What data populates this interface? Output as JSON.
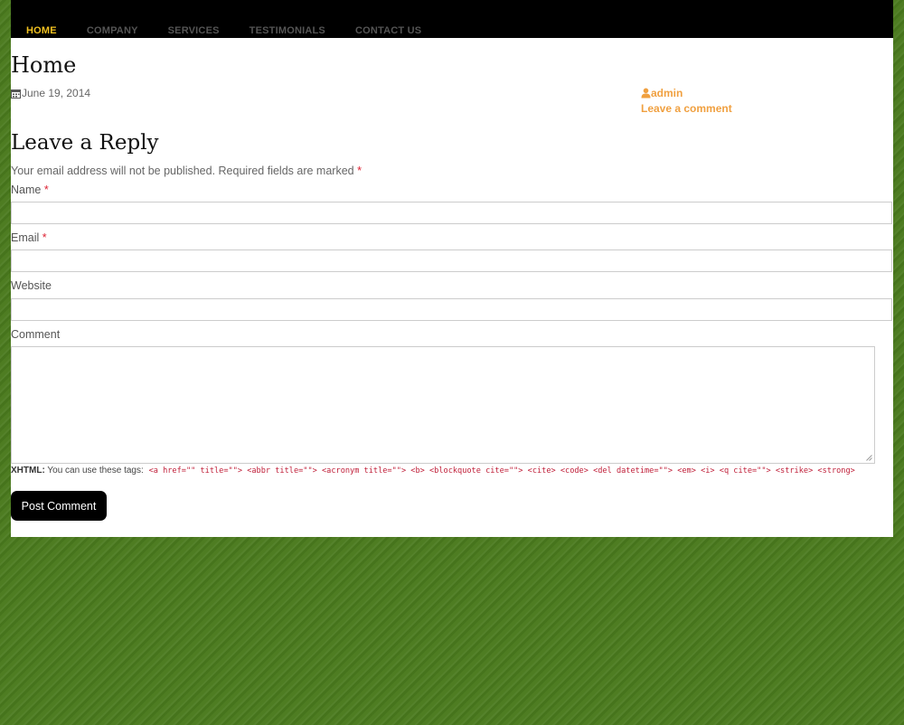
{
  "nav": {
    "items": [
      {
        "label": "HOME",
        "active": true
      },
      {
        "label": "COMPANY",
        "active": false
      },
      {
        "label": "SERVICES",
        "active": false
      },
      {
        "label": "TESTIMONIALS",
        "active": false
      },
      {
        "label": "CONTACT US",
        "active": false
      }
    ]
  },
  "post": {
    "title": "Home",
    "date": "June 19, 2014",
    "author": "admin",
    "comment_link": "Leave a comment"
  },
  "reply": {
    "title": "Leave a Reply",
    "notes": "Your email address will not be published. Required fields are marked",
    "required_mark": "*",
    "fields": {
      "name_label": "Name",
      "email_label": "Email",
      "website_label": "Website",
      "comment_label": "Comment"
    },
    "xhtml_label": "XHTML:",
    "xhtml_text": "You can use these tags:",
    "allowed_tags": "<a href=\"\" title=\"\"> <abbr title=\"\"> <acronym title=\"\"> <b> <blockquote cite=\"\"> <cite> <code> <del datetime=\"\"> <em> <i> <q cite=\"\"> <strike> <strong>",
    "submit_label": "Post Comment"
  },
  "colors": {
    "nav_active": "#f0c020",
    "meta_link": "#f0a040",
    "required": "#dd2233",
    "background": "#4a7a1e"
  }
}
